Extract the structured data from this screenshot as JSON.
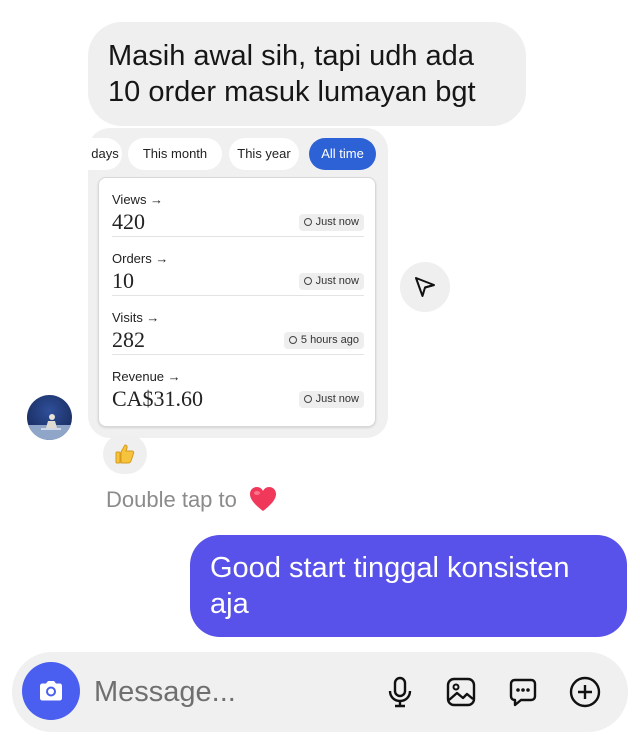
{
  "incoming_message": {
    "line1": "Masih awal sih, tapi udh ada",
    "line2": "10 order masuk lumayan bgt"
  },
  "shared_screenshot": {
    "tabs": [
      {
        "label": "days",
        "active": false
      },
      {
        "label": "This month",
        "active": false
      },
      {
        "label": "This year",
        "active": false
      },
      {
        "label": "All time",
        "active": true
      }
    ],
    "stats": [
      {
        "label": "Views →",
        "value": "420",
        "time": "Just now"
      },
      {
        "label": "Orders →",
        "value": "10",
        "time": "Just now"
      },
      {
        "label": "Visits →",
        "value": "282",
        "time": "5 hours ago"
      },
      {
        "label": "Revenue →",
        "value": "CA$31.60",
        "time": "Just now"
      }
    ],
    "accent_color": "#2d62d6"
  },
  "reaction": {
    "icon": "thumbs-up-emoji"
  },
  "hint": {
    "text": "Double tap to",
    "icon": "heart-emoji"
  },
  "outgoing_message": {
    "line1": "Good start tinggal konsisten",
    "line2": "aja",
    "bubble_color": "#5851ea"
  },
  "composer": {
    "placeholder": "Message...",
    "camera_button_color": "#4a5ef0",
    "icons": [
      "microphone-icon",
      "gallery-icon",
      "sticker-icon",
      "plus-icon"
    ]
  }
}
